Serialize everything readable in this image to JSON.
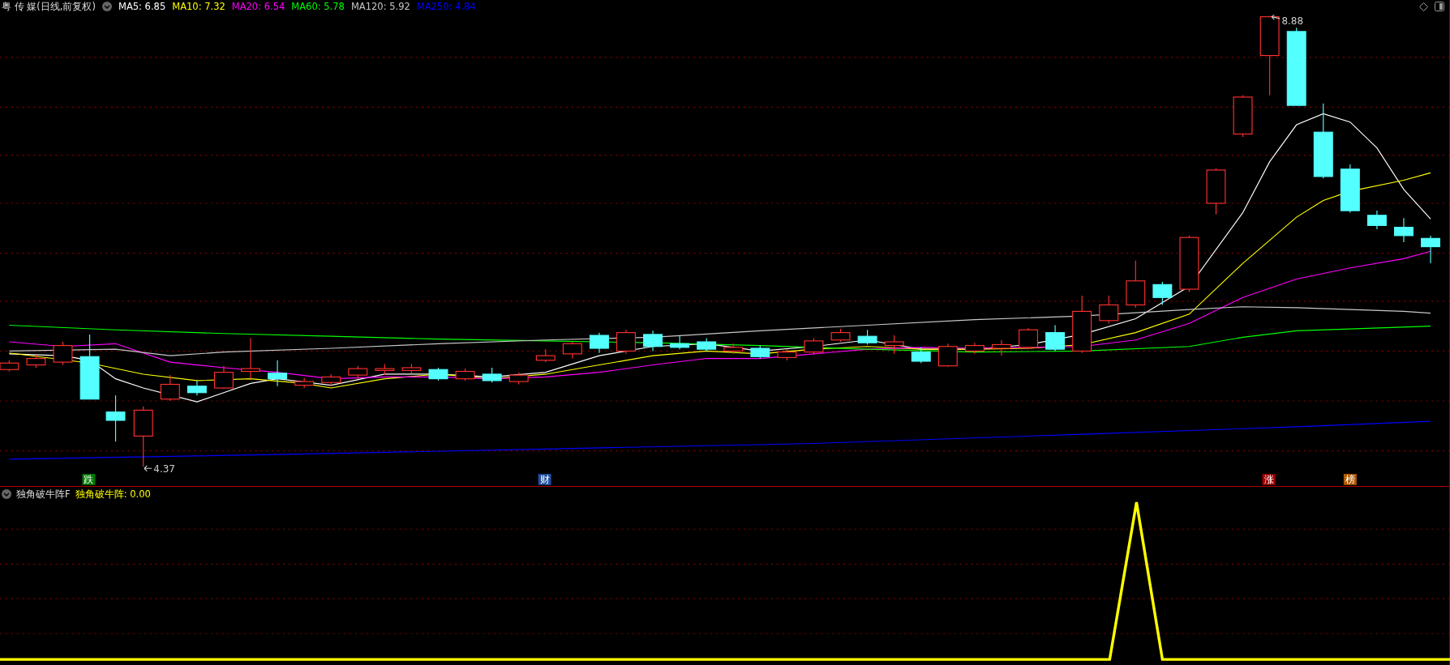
{
  "chart": {
    "title": "粤 传 媒(日线,前复权)",
    "moving_averages": [
      {
        "label": "MA5: 6.85",
        "color": "#ffffff"
      },
      {
        "label": "MA10: 7.32",
        "color": "#ffff00"
      },
      {
        "label": "MA20: 6.54",
        "color": "#ff00ff"
      },
      {
        "label": "MA60: 5.78",
        "color": "#00ff00"
      },
      {
        "label": "MA120: 5.92",
        "color": "#c8c8c8"
      },
      {
        "label": "MA250: 4.84",
        "color": "#0000ff"
      }
    ],
    "high_label": "8.88",
    "low_label": "4.37",
    "signal_tags": [
      {
        "text": "跌",
        "color": "#007a00"
      },
      {
        "text": "财",
        "color": "#1f4f9f"
      },
      {
        "text": "涨",
        "color": "#a00000"
      },
      {
        "text": "榜",
        "color": "#b05a00"
      }
    ]
  },
  "indicator": {
    "name": "独角破牛阵F",
    "value": "独角破牛阵: 0.00"
  }
}
